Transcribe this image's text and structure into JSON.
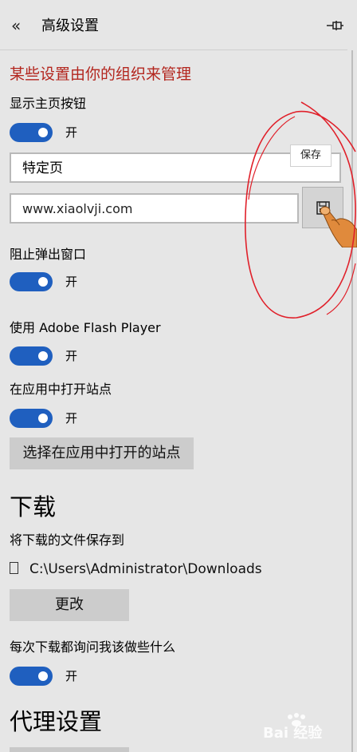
{
  "header": {
    "back_icon": "«",
    "title": "高级设置",
    "pin_icon": "pin-icon"
  },
  "managed_notice": "某些设置由你的组织来管理",
  "home_button": {
    "label": "显示主页按钮",
    "toggle_state": "开",
    "select_value": "特定页",
    "url_value": "www.xiaolvji.com",
    "save_tooltip": "保存"
  },
  "popups": {
    "label": "阻止弹出窗口",
    "toggle_state": "开"
  },
  "flash": {
    "label": "使用 Adobe Flash Player",
    "toggle_state": "开"
  },
  "open_in_app": {
    "label": "在应用中打开站点",
    "toggle_state": "开",
    "button_label": "选择在应用中打开的站点"
  },
  "downloads": {
    "section_title": "下载",
    "save_to_label": "将下载的文件保存到",
    "path": "C:\\Users\\Administrator\\Downloads",
    "change_button": "更改",
    "ask_label": "每次下载都询问我该做些什么",
    "toggle_state": "开"
  },
  "proxy": {
    "section_title": "代理设置"
  },
  "watermark": {
    "text": "Bai 经验"
  },
  "colors": {
    "accent": "#1f5fbf",
    "managed_text": "#b3261e",
    "annotation": "#e0202a"
  }
}
